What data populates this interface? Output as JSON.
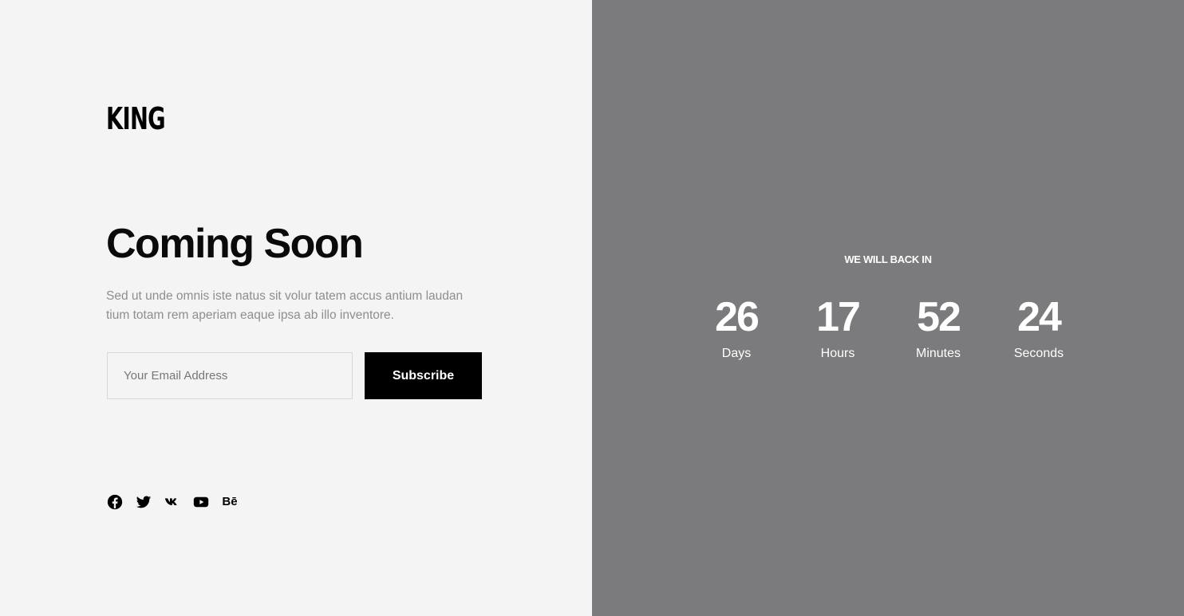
{
  "brand": {
    "logo": "KING"
  },
  "hero": {
    "title": "Coming Soon",
    "description": "Sed ut unde omnis iste natus sit volur tatem accus antium laudan tium totam rem aperiam eaque ipsa ab illo inventore."
  },
  "subscribe_form": {
    "email_placeholder": "Your Email Address",
    "email_value": "",
    "button_label": "Subscribe"
  },
  "social": {
    "items": [
      {
        "icon": "facebook-icon"
      },
      {
        "icon": "twitter-icon"
      },
      {
        "icon": "vk-icon"
      },
      {
        "icon": "youtube-icon"
      },
      {
        "icon": "behance-icon",
        "text": "Bē"
      }
    ]
  },
  "countdown": {
    "label": "WE WILL BACK IN",
    "units": [
      {
        "value": "26",
        "label": "Days"
      },
      {
        "value": "17",
        "label": "Hours"
      },
      {
        "value": "52",
        "label": "Minutes"
      },
      {
        "value": "24",
        "label": "Seconds"
      }
    ]
  },
  "colors": {
    "left_background": "#f4f4f4",
    "right_background": "#7b7b7d",
    "accent": "#000000",
    "text_light": "#ffffff"
  }
}
